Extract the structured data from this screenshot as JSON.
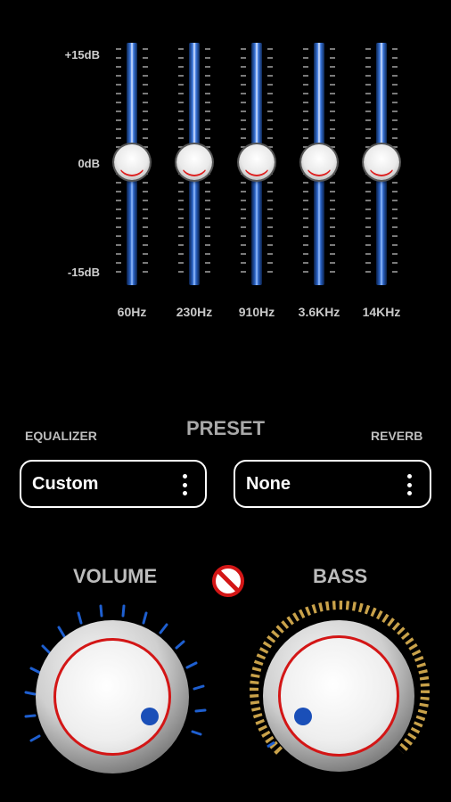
{
  "eq": {
    "db_labels": {
      "top": "+15dB",
      "mid": "0dB",
      "bottom": "-15dB"
    },
    "bands": [
      {
        "freq": "60Hz",
        "gain_db": 0
      },
      {
        "freq": "230Hz",
        "gain_db": 0
      },
      {
        "freq": "910Hz",
        "gain_db": 0
      },
      {
        "freq": "3.6KHz",
        "gain_db": 0
      },
      {
        "freq": "14KHz",
        "gain_db": 0
      }
    ]
  },
  "preset": {
    "title": "PRESET",
    "equalizer_label": "EQUALIZER",
    "reverb_label": "REVERB",
    "equalizer_value": "Custom",
    "reverb_value": "None"
  },
  "knobs": {
    "volume_label": "VOLUME",
    "bass_label": "BASS"
  },
  "icons": {
    "mute": "no-sign-icon",
    "menu": "kebab-menu-icon"
  },
  "colors": {
    "accent_blue": "#1a4fb8",
    "accent_red": "#d31616",
    "bass_ring": "#c9a24a"
  }
}
